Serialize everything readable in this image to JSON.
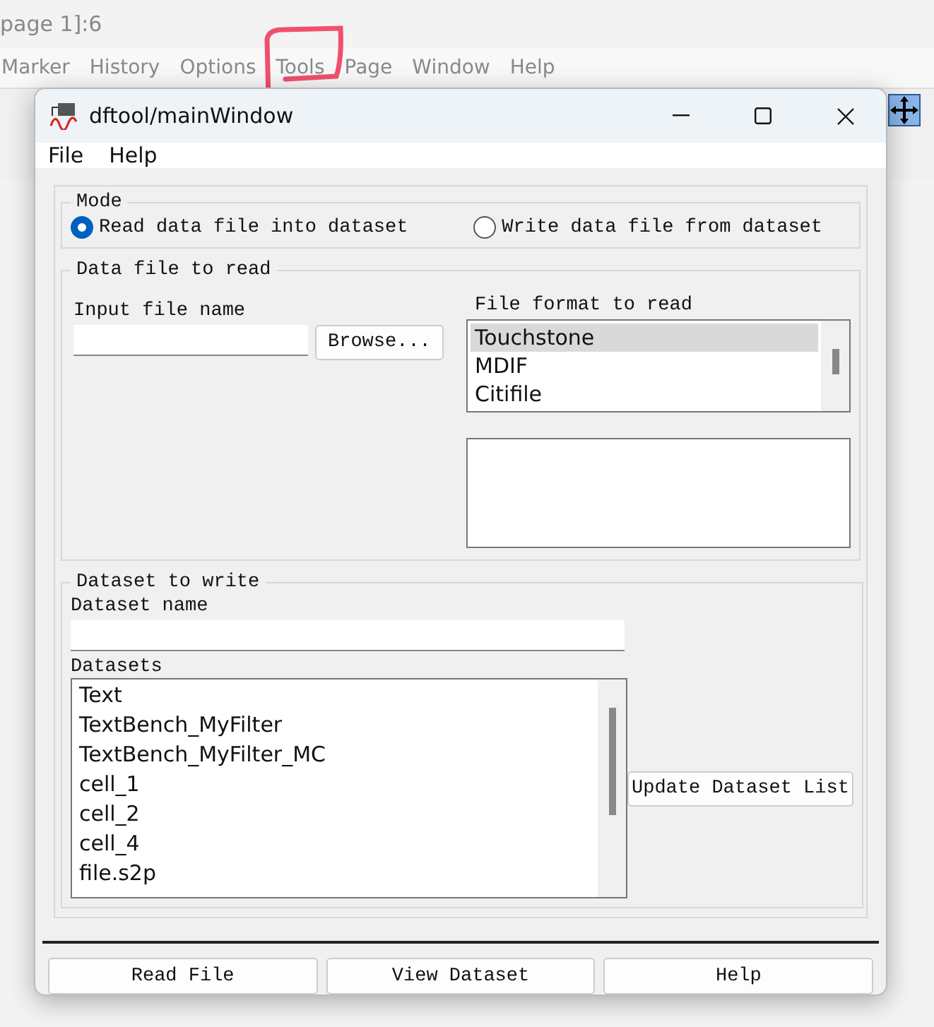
{
  "background_app": {
    "title": "page 1]:6",
    "menu": [
      {
        "label": "Marker",
        "highlighted": false
      },
      {
        "label": "History",
        "highlighted": false
      },
      {
        "label": "Options",
        "highlighted": false
      },
      {
        "label": "Tools",
        "highlighted": true
      },
      {
        "label": "Page",
        "highlighted": false
      },
      {
        "label": "Window",
        "highlighted": false
      },
      {
        "label": "Help",
        "highlighted": false
      }
    ]
  },
  "window": {
    "title": "dftool/mainWindow"
  },
  "menu": [
    "File",
    "Help"
  ],
  "mode": {
    "title": "Mode",
    "options": [
      {
        "label": "Read data file into dataset",
        "selected": true
      },
      {
        "label": "Write data file from dataset",
        "selected": false
      }
    ]
  },
  "data_file": {
    "title": "Data file to read",
    "input_label": "Input file name",
    "browse": "Browse...",
    "format_label": "File format to read",
    "formats": [
      {
        "label": "Touchstone",
        "selected": true
      },
      {
        "label": "MDIF",
        "selected": false
      },
      {
        "label": "Citifile",
        "selected": false
      }
    ]
  },
  "dataset": {
    "title": "Dataset to write",
    "name_label": "Dataset name",
    "list_label": "Datasets",
    "items": [
      "Text",
      "TextBench_MyFilter",
      "TextBench_MyFilter_MC",
      "cell_1",
      "cell_2",
      "cell_4",
      "file.s2p"
    ],
    "update": "Update Dataset List"
  },
  "buttons": [
    "Read File",
    "View Dataset",
    "Help"
  ]
}
